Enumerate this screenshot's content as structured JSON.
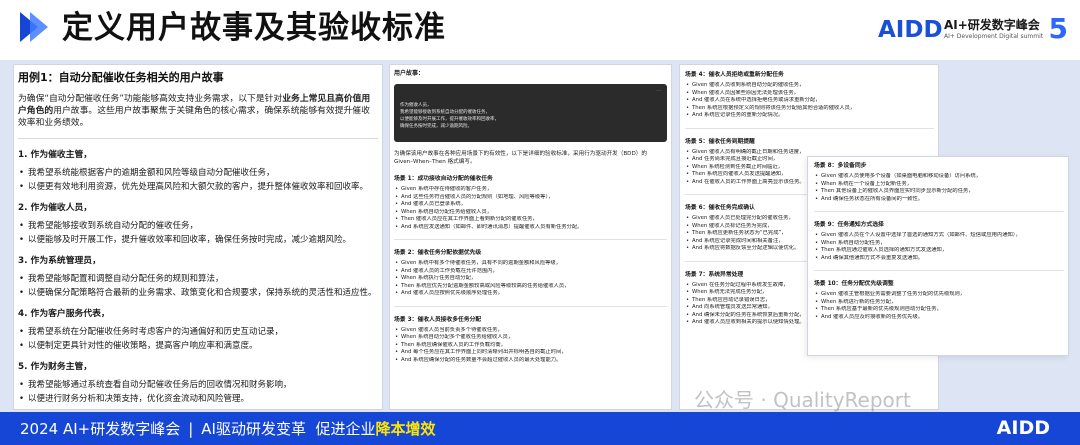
{
  "header": {
    "title": "定义用户故事及其验收标准",
    "logo": {
      "mark": "AIDD",
      "name": "AI+研发数字峰会",
      "subtitle": "AI+ Development Digital summit",
      "edition": "5"
    }
  },
  "left": {
    "case_title": "用例1：自动分配催收任务相关的用户故事",
    "intro_a": "为确保“自动分配催收任务”功能能够高效支持业务需求，以下是针对",
    "intro_bold": "业务上常见且高价值用户角色的",
    "intro_b": "用户故事。这些用户故事聚焦于关键角色的核心需求，确保系统能够有效提升催收效率和业务绩效。",
    "roles": [
      {
        "title": "1. 作为催收主管，",
        "items": [
          "我希望系统能根据客户的逾期金额和风险等级自动分配催收任务，",
          "以便更有效地利用资源，优先处理高风险和大额欠款的客户，提升整体催收效率和回收率。"
        ]
      },
      {
        "title": "2. 作为催收人员，",
        "items": [
          "我希望能够接收到系统自动分配的催收任务，",
          "以便能够及时开展工作，提升催收效率和回收率，确保任务按时完成，减少逾期风险。"
        ]
      },
      {
        "title": "3. 作为系统管理员，",
        "items": [
          "我希望能够配置和调整自动分配任务的规则和算法，",
          "以便确保分配策略符合最新的业务需求、政策变化和合规要求，保持系统的灵活性和适应性。"
        ]
      },
      {
        "title": "4. 作为客户服务代表，",
        "items": [
          "我希望系统在分配催收任务时考虑客户的沟通偏好和历史互动记录，",
          "以便制定更具针对性的催收策略，提高客户响应率和满意度。"
        ]
      },
      {
        "title": "5. 作为财务主管，",
        "items": [
          "我希望能够通过系统查看自动分配催收任务后的回收情况和财务影响，",
          "以便进行财务分析和决策支持，优化资金流动和风险管理。"
        ]
      }
    ]
  },
  "mid": {
    "prompt_title": "用户故事：",
    "code_dots": "···",
    "code_lines": [
      "作为催收人员，",
      "我希望能够接收到系统自动分配的催收任务，",
      "以便能够及时开展工作，提升催收效率和回收率，",
      "确保任务按时完成，减少逾期风险。"
    ],
    "note": "为确保该用户故事在各种应用场景下的有效性，以下是详细的验收标准，采用行为驱动开发（BDD）的 Given–When–Then 格式编写。",
    "scenarios": [
      {
        "title": "场景 1：成功接收自动分配的催收任务",
        "items": [
          "Given 系统中存在待催收的客户任务，",
          "And 这些任务符合催收人员的分配规则（如地理、风险等级等），",
          "And 催收人员已登录系统，",
          "When 系统自动分配任务给催收人员，",
          "Then 催收人员应在其工作界面上看到新分配的催收任务，",
          "And 系统应发送通知（如邮件、即时通讯消息）提醒催收人员有新任务分配。"
        ]
      },
      {
        "title": "场景 2：催收任务分配依据优先级",
        "items": [
          "Given 系统中有多个待催收任务，具有不同的逾期金额和风险等级，",
          "And 催收人员的工作负载在允许范围内，",
          "When 系统执行任务自动分配，",
          "Then 系统应优先分配逾期金额较高或风险等级较高的任务给催收人员，",
          "And 催收人员应按照优先级顺序处理任务。"
        ]
      },
      {
        "title": "场景 3：催收人员接收多任务分配",
        "items": [
          "Given 催收人员当前负责多个待催收任务，",
          "When 系统自动分配多个催收任务给催收人员，",
          "Then 系统应确保催收人员的工作负载均衡，",
          "And 每个任务应在其工作界面上同时清晰列出并标明各自的截止时间，",
          "And 系统应确保分配的任务数量不会超过催收人员的最大处理能力。"
        ]
      }
    ]
  },
  "right1": {
    "scenarios": [
      {
        "title": "场景 4：催收人员拒绝或重新分配任务",
        "items": [
          "Given 催收人员收到系统自动分配的催收任务，",
          "When 催收人员因某些原因无法处理该任务，",
          "And 催收人员在系统中选择拒绝任务或请求重新分配，",
          "Then 系统应根据预定义的规则将该任务分配给其他合适的催收人员，",
          "And 系统应记录任务的重新分配情况。"
        ]
      },
      {
        "title": "场景 5：催收任务到期提醒",
        "items": [
          "Given 催收人员有明确的截止日期和任务进度，",
          "And 任务尚未完成且接近截止时间，",
          "When 系统检测到任务截止时间临近，",
          "Then 系统应向催收人员发送提醒通知，",
          "And 在催收人员的工作界面上高亮显示该任务。"
        ]
      },
      {
        "title": "场景 6：催收任务完成确认",
        "items": [
          "Given 催收人员已处理完分配的催收任务，",
          "When 催收人员标记任务为完成，",
          "Then 系统应更新任务状态为“已完成”，",
          "And 系统应记录完成时间和相关备注，",
          "And 系统应将数据反馈至分配逻辑以便优化。"
        ]
      },
      {
        "title": "场景 7：系统异常处理",
        "items": [
          "Given 在任务分配过程中系统发生故障，",
          "When 系统无法完成任务分配，",
          "Then 系统应自动记录错误日志，",
          "And 向系统管理员发送异常通知，",
          "And 确保未分配的任务在系统恢复后重新分配，",
          "And 催收人员应收到相关的提示以便知情处理。"
        ]
      }
    ]
  },
  "right2": {
    "scenarios": [
      {
        "title": "场景 8：多设备同步",
        "items": [
          "Given 催收人员使用多个设备（如桌面电脑和移动设备）访问系统，",
          "When 系统在一个设备上分配新任务，",
          "Then 其他设备上的催收人员界面应实时同步显示新分配的任务，",
          "And 确保任务状态在所有设备间的一致性。"
        ]
      },
      {
        "title": "场景 9：任务通知方式选择",
        "items": [
          "Given 催收人员在个人设置中选择了首选的通知方式（如邮件、短信或应用内通知），",
          "When 系统自动分配任务，",
          "Then 系统应通过催收人员选择的通知方式发送通知，",
          "And 确保其他通知方式不会重复发送通知。"
        ]
      },
      {
        "title": "场景 10：任务分配优先级调整",
        "items": [
          "Given 催收主管根据业务需要调整了任务分配的优先级规则，",
          "When 系统进行新的任务分配，",
          "Then 系统应基于最新的优先级规则自动分配任务，",
          "And 催收人员应及时接收新的任务优先级。"
        ]
      }
    ]
  },
  "footer": {
    "part1": "2024 AI+研发数字峰会",
    "part2": "AI驱动研发变革",
    "part3": "促进企业",
    "part3_hl": "降本增效",
    "logo": "AIDD"
  },
  "watermark": "公众号 · QualityReport",
  "colors": {
    "brand_blue": "#1546d6",
    "highlight_yellow": "#ffe600",
    "stage_bg": "#dde5f5"
  }
}
